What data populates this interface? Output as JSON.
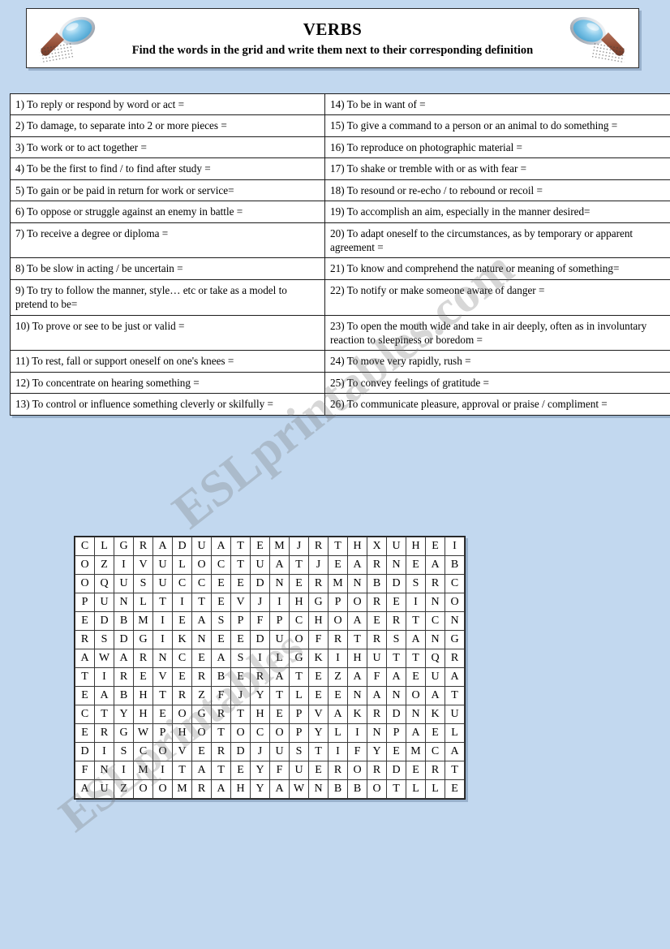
{
  "header": {
    "title": "VERBS",
    "instruction": "Find the words in the grid and write them next to their corresponding definition",
    "left_icon": "magnifying-glass-icon",
    "right_icon": "magnifying-glass-icon"
  },
  "colors": {
    "page_background": "#c2d8ef",
    "panel_background": "#ffffff",
    "border": "#1c1c1c",
    "shadow": "#7891af",
    "lens": "#7fc4e8",
    "handle": "#9e5b42"
  },
  "definitions": {
    "left": [
      "1) To reply or respond by word or act =",
      "2) To damage, to separate into 2 or more pieces =",
      "3) To work or to act together =",
      "4) To be the first to find /  to find after study =",
      "5) To gain or be paid in return for work or service=",
      "6) To oppose or struggle against an enemy in battle =",
      "7) To receive a degree or diploma =",
      "8) To be slow in acting / be uncertain =",
      "9) To try to follow the manner, style… etc or take as a model to pretend to be=",
      "10) To prove or see to be just or valid =",
      "11) To rest, fall or support oneself on one's knees =",
      "12) To concentrate on hearing something =",
      "13) To control or influence something cleverly or skilfully ="
    ],
    "right": [
      "14) To be in want of =",
      "15) To give a command to a person or an animal to do something =",
      "16) To reproduce on photographic material =",
      "17) To shake or tremble with or as with fear  =",
      "18) To resound or re-echo / to rebound or recoil =",
      "19) To accomplish an aim, especially in the manner desired=",
      "20) To adapt oneself to the circumstances, as by temporary or apparent agreement =",
      "21) To know and comprehend the nature or meaning of something=",
      "22) To notify or make someone aware of danger =",
      "23) To open the mouth wide and take in air deeply, often as in involuntary reaction to sleepiness or boredom =",
      "24) To move very rapidly, rush =",
      "25) To convey feelings of gratitude =",
      "26) To communicate pleasure, approval or praise / compliment ="
    ]
  },
  "wordsearch": {
    "rows": 14,
    "cols": 19,
    "letters": [
      [
        "C",
        "L",
        "G",
        "R",
        "A",
        "D",
        "U",
        "A",
        "T",
        "E",
        "M",
        "J",
        "R",
        "T",
        "H",
        "X",
        "U",
        "H",
        "E",
        "I"
      ],
      [
        "O",
        "Z",
        "I",
        "V",
        "U",
        "L",
        "O",
        "C",
        "T",
        "U",
        "A",
        "T",
        "J",
        "E",
        "A",
        "R",
        "N",
        "E",
        "A",
        "B"
      ],
      [
        "O",
        "Q",
        "U",
        "S",
        "U",
        "C",
        "C",
        "E",
        "E",
        "D",
        "N",
        "E",
        "R",
        "M",
        "N",
        "B",
        "D",
        "S",
        "R",
        "C"
      ],
      [
        "P",
        "U",
        "N",
        "L",
        "T",
        "I",
        "T",
        "E",
        "V",
        "J",
        "I",
        "H",
        "G",
        "P",
        "O",
        "R",
        "E",
        "I",
        "N",
        "O"
      ],
      [
        "E",
        "D",
        "B",
        "M",
        "I",
        "E",
        "A",
        "S",
        "P",
        "F",
        "P",
        "C",
        "H",
        "O",
        "A",
        "E",
        "R",
        "T",
        "C",
        "N"
      ],
      [
        "R",
        "S",
        "D",
        "G",
        "I",
        "K",
        "N",
        "E",
        "E",
        "D",
        "U",
        "O",
        "F",
        "R",
        "T",
        "R",
        "S",
        "A",
        "N",
        "G"
      ],
      [
        "A",
        "W",
        "A",
        "R",
        "N",
        "C",
        "E",
        "A",
        "S",
        "I",
        "L",
        "G",
        "K",
        "I",
        "H",
        "U",
        "T",
        "T",
        "Q",
        "R"
      ],
      [
        "T",
        "I",
        "R",
        "E",
        "V",
        "E",
        "R",
        "B",
        "E",
        "R",
        "A",
        "T",
        "E",
        "Z",
        "A",
        "F",
        "A",
        "E",
        "U",
        "A"
      ],
      [
        "E",
        "A",
        "B",
        "H",
        "T",
        "R",
        "Z",
        "F",
        "J",
        "Y",
        "T",
        "L",
        "E",
        "E",
        "N",
        "A",
        "N",
        "O",
        "A",
        "T"
      ],
      [
        "C",
        "T",
        "Y",
        "H",
        "E",
        "O",
        "G",
        "R",
        "T",
        "H",
        "E",
        "P",
        "V",
        "A",
        "K",
        "R",
        "D",
        "N",
        "K",
        "U"
      ],
      [
        "E",
        "R",
        "G",
        "W",
        "P",
        "H",
        "O",
        "T",
        "O",
        "C",
        "O",
        "P",
        "Y",
        "L",
        "I",
        "N",
        "P",
        "A",
        "E",
        "L"
      ],
      [
        "D",
        "I",
        "S",
        "C",
        "O",
        "V",
        "E",
        "R",
        "D",
        "J",
        "U",
        "S",
        "T",
        "I",
        "F",
        "Y",
        "E",
        "M",
        "C",
        "A"
      ],
      [
        "F",
        "N",
        "I",
        "M",
        "I",
        "T",
        "A",
        "T",
        "E",
        "Y",
        "F",
        "U",
        "E",
        "R",
        "O",
        "R",
        "D",
        "E",
        "R",
        "T"
      ],
      [
        "A",
        "U",
        "Z",
        "O",
        "O",
        "M",
        "R",
        "A",
        "H",
        "Y",
        "A",
        "W",
        "N",
        "B",
        "B",
        "O",
        "T",
        "L",
        "L",
        "E"
      ]
    ]
  },
  "watermark": {
    "line_a": "ESLprintables.com",
    "line_b": "ESLprintables"
  }
}
